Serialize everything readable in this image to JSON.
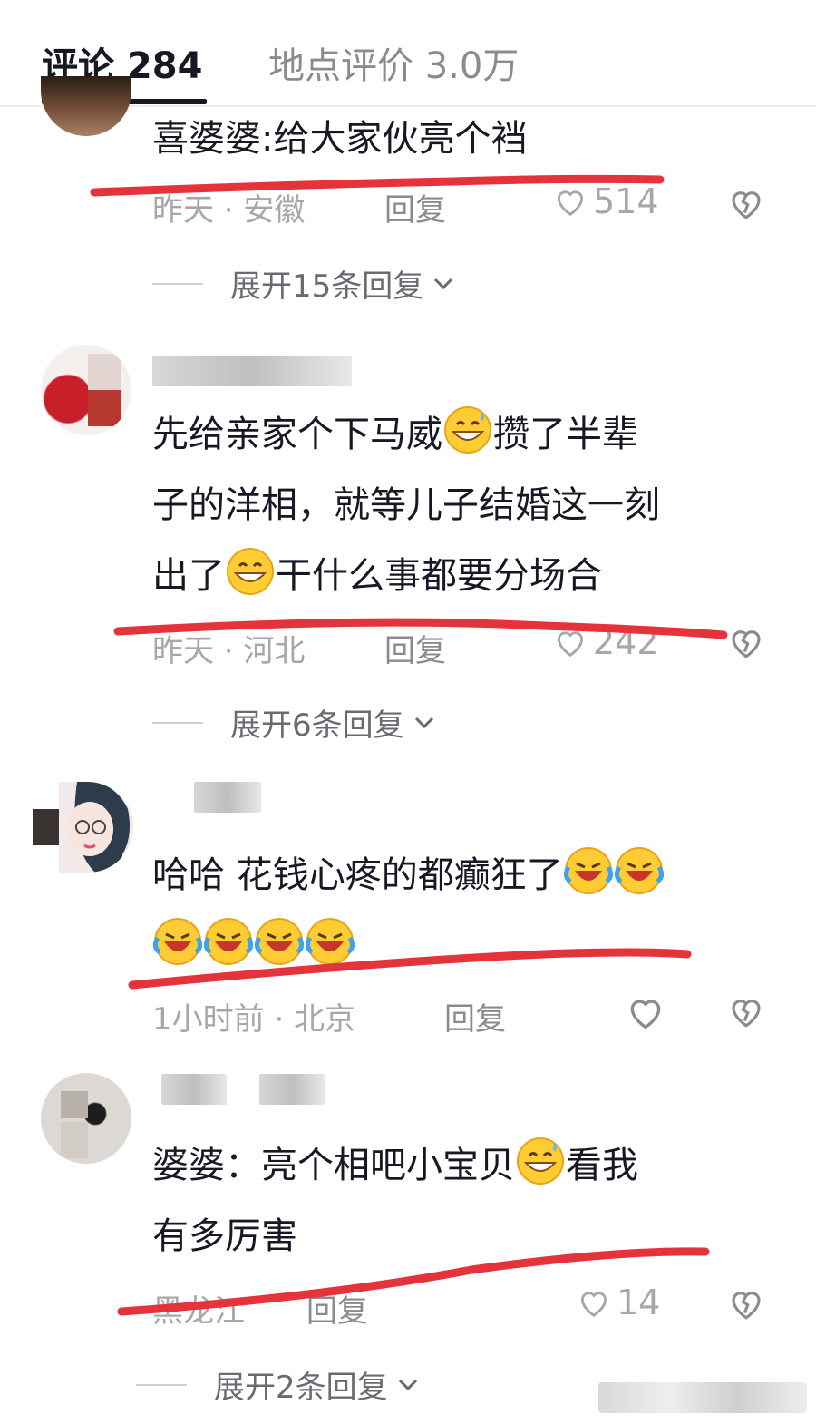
{
  "tabs": {
    "comments_label": "评论 284",
    "place_reviews_label": "地点评价 3.0万"
  },
  "comments": [
    {
      "text": "喜婆婆:给大家伙亮个裆",
      "time": "昨天 · 安徽",
      "reply_label": "回复",
      "likes": "514",
      "expand_label": "展开15条回复"
    },
    {
      "line1": "先给亲家个下马威",
      "line1b": "攒了半辈",
      "line2": "子的洋相，就等儿子结婚这一刻",
      "line3a": "出了",
      "line3b": "干什么事都要分场合",
      "time": "昨天 · 河北",
      "reply_label": "回复",
      "likes": "242",
      "expand_label": "展开6条回复"
    },
    {
      "line1": "哈哈 花钱心疼的都癫狂了",
      "time": "1小时前 · 北京",
      "reply_label": "回复",
      "likes": ""
    },
    {
      "line1": "婆婆：亮个相吧小宝贝",
      "line1b": "看我",
      "line2": "有多厉害",
      "time": "黑龙江",
      "reply_label": "回复",
      "likes": "14",
      "expand_label": "展开2条回复"
    }
  ],
  "colors": {
    "annotation_red": "#e5333b",
    "text_primary": "#161823",
    "text_secondary": "#a6a7ab"
  },
  "icons": {
    "like": "heart-outline-icon",
    "dislike": "broken-heart-icon",
    "expand": "chevron-down-icon"
  }
}
